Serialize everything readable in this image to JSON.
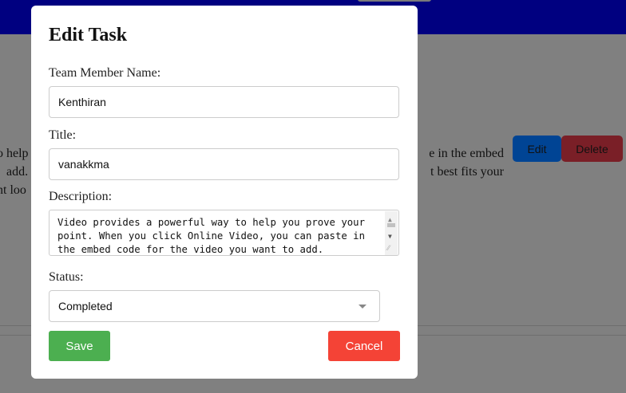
{
  "background": {
    "text_left": [
      "o help",
      "add.",
      "nt loo"
    ],
    "text_right": [
      "e in the embed",
      "t best fits your"
    ],
    "edit_label": "Edit",
    "delete_label": "Delete"
  },
  "modal": {
    "title": "Edit Task",
    "name_label": "Team Member Name:",
    "name_value": "Kenthiran",
    "title_label": "Title:",
    "title_value": "vanakkma",
    "description_label": "Description:",
    "description_value": "Video provides a powerful way to help you prove your point. When you click Online Video, you can paste in the embed code for the video you want to add.",
    "status_label": "Status:",
    "status_value": "Completed",
    "save_label": "Save",
    "cancel_label": "Cancel"
  },
  "colors": {
    "header": "#000080",
    "overlay": "#808080",
    "save": "#4caf50",
    "cancel": "#f44336"
  }
}
